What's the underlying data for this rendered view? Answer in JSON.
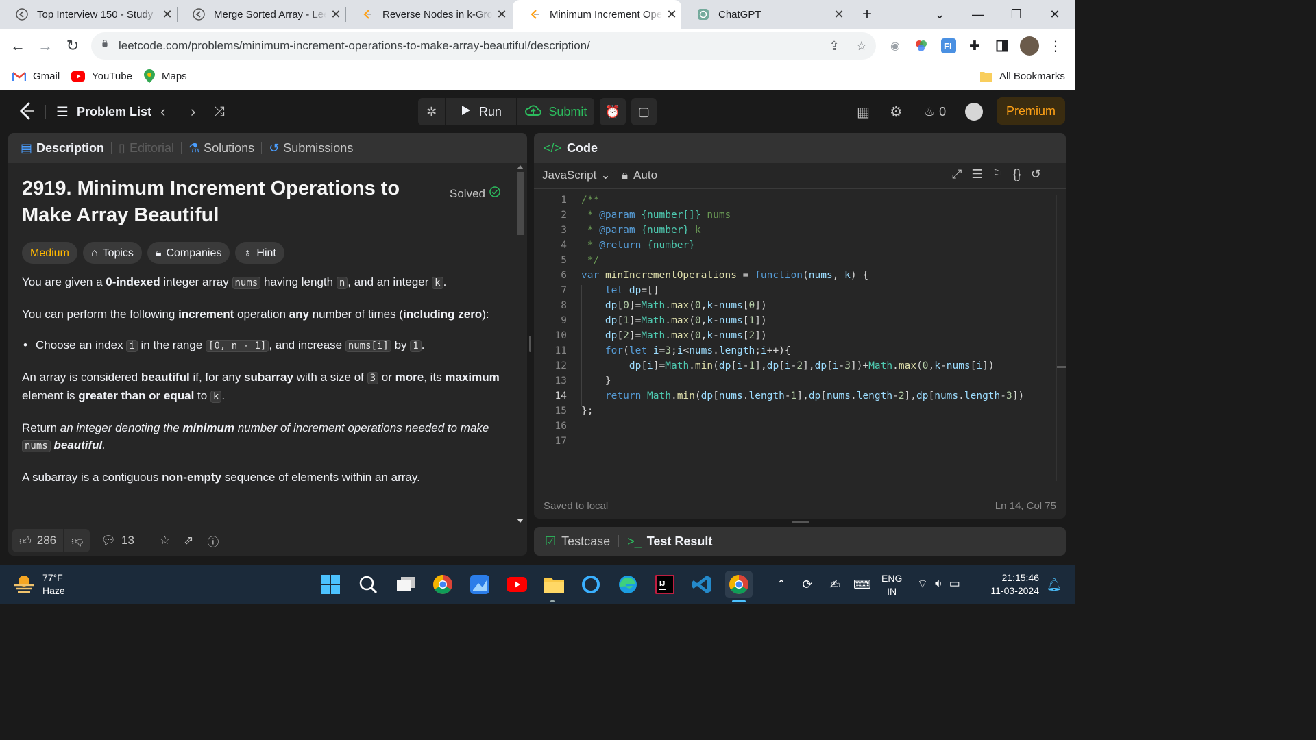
{
  "browser": {
    "tabs": [
      {
        "title": "Top Interview 150 - Study",
        "active": false
      },
      {
        "title": "Merge Sorted Array - LeetCode",
        "active": false
      },
      {
        "title": "Reverse Nodes in k-Group",
        "active": false
      },
      {
        "title": "Minimum Increment Operations",
        "active": true
      },
      {
        "title": "ChatGPT",
        "active": false
      }
    ],
    "new_tab": "+",
    "url": "leetcode.com/problems/minimum-increment-operations-to-make-array-beautiful/description/",
    "bookmarks": [
      "Gmail",
      "YouTube",
      "Maps"
    ],
    "all_bookmarks": "All Bookmarks"
  },
  "lc_nav": {
    "problem_list": "Problem List",
    "run": "Run",
    "submit": "Submit",
    "streak": "0",
    "premium": "Premium"
  },
  "description": {
    "tabs": [
      "Description",
      "Editorial",
      "Solutions",
      "Submissions"
    ],
    "title": "2919. Minimum Increment Operations to Make Array Beautiful",
    "solved": "Solved",
    "chips": [
      "Medium",
      "Topics",
      "Companies",
      "Hint"
    ],
    "p1": {
      "a": "You are given a ",
      "b": "0-indexed",
      "c": " integer array ",
      "d": "nums",
      "e": " having length ",
      "f": "n",
      "g": ", and an integer ",
      "h": "k",
      "i": "."
    },
    "p2": {
      "a": "You can perform the following ",
      "b": "increment",
      "c": " operation ",
      "d": "any",
      "e": " number of times (",
      "f": "including zero",
      "g": "):"
    },
    "bullet": {
      "a": "Choose an index ",
      "b": "i",
      "c": " in the range ",
      "d": "[0, n - 1]",
      "e": ", and increase ",
      "f": "nums[i]",
      "g": " by ",
      "h": "1",
      "i": "."
    },
    "p3": {
      "a": "An array is considered ",
      "b": "beautiful",
      "c": " if, for any ",
      "d": "subarray",
      "e": " with a size of ",
      "f": "3",
      "g": " or ",
      "h": "more",
      "i": ", its ",
      "j": "maximum",
      "k": " element is ",
      "l": "greater than or equal",
      "m": " to ",
      "n": "k",
      "o": "."
    },
    "p4": {
      "a": "Return ",
      "b": "an integer denoting the ",
      "c": "minimum",
      "d": " number of increment operations needed to make ",
      "e": "nums",
      "f": "beautiful",
      "g": "."
    },
    "p5": {
      "a": "A subarray is a contiguous ",
      "b": "non-empty",
      "c": " sequence of elements within an array."
    },
    "likes": "286",
    "comments": "13"
  },
  "code": {
    "header": "Code",
    "language": "JavaScript",
    "mode": "Auto",
    "line_numbers": [
      "1",
      "2",
      "3",
      "4",
      "5",
      "6",
      "7",
      "8",
      "9",
      "10",
      "11",
      "12",
      "13",
      "14",
      "15",
      "16",
      "17"
    ],
    "current_line": 14,
    "lines": [
      "/**",
      " * @param {number[]} nums",
      " * @param {number} k",
      " * @return {number}",
      " */",
      "var minIncrementOperations = function(nums, k) {",
      "    let dp=[]",
      "    dp[0]=Math.max(0,k-nums[0])",
      "    dp[1]=Math.max(0,k-nums[1])",
      "    dp[2]=Math.max(0,k-nums[2])",
      "    for(let i=3;i<nums.length;i++){",
      "        dp[i]=Math.min(dp[i-1],dp[i-2],dp[i-3])+Math.max(0,k-nums[i])",
      "    }",
      "    return Math.min(dp[nums.length-1],dp[nums.length-2],dp[nums.length-3])",
      "};",
      "",
      ""
    ],
    "saved": "Saved to local",
    "cursor": "Ln 14, Col 75"
  },
  "result_panel": {
    "testcase": "Testcase",
    "test_result": "Test Result"
  },
  "taskbar": {
    "weather_temp": "77°F",
    "weather_desc": "Haze",
    "lang": "ENG",
    "region": "IN",
    "time": "21:15:46",
    "date": "11-03-2024"
  },
  "colors": {
    "brand_orange": "#ffa116",
    "medium": "#ffb800",
    "submit_green": "#2cbb5d",
    "solved_green": "#2cbb5d"
  }
}
